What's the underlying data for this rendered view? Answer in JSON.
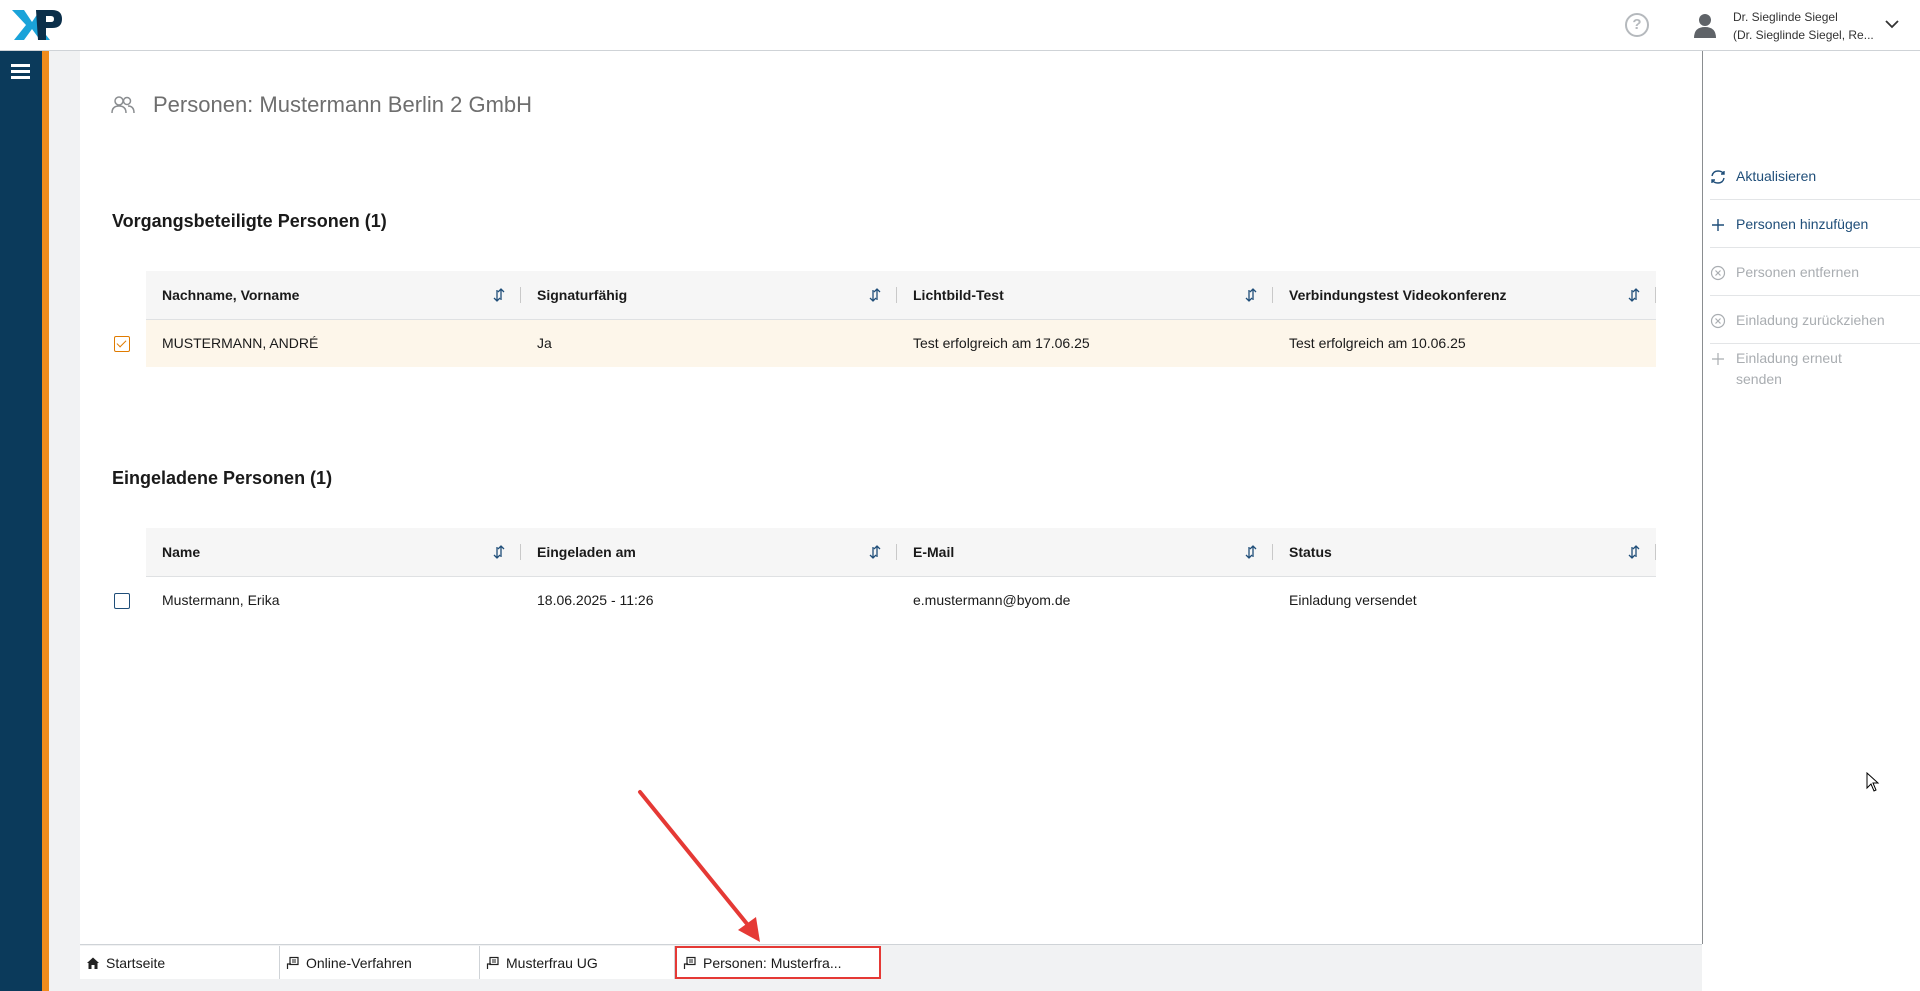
{
  "header": {
    "logo_text": "XP",
    "help_symbol": "?",
    "user": {
      "name": "Dr. Sieglinde Siegel",
      "role": "(Dr. Sieglinde Siegel, Re..."
    }
  },
  "page": {
    "title": "Personen: Mustermann Berlin 2 GmbH"
  },
  "participants": {
    "title": "Vorgangsbeteiligte Personen (1)",
    "columns": [
      "Nachname, Vorname",
      "Signaturfähig",
      "Lichtbild-Test",
      "Verbindungstest Videokonferenz"
    ],
    "rows": [
      {
        "checked": true,
        "name": "MUSTERMANN, ANDRÉ",
        "signature": "Ja",
        "photo_test": "Test erfolgreich am 17.06.25",
        "video_test": "Test erfolgreich am 10.06.25"
      }
    ]
  },
  "invited": {
    "title": "Eingeladene Personen (1)",
    "columns": [
      "Name",
      "Eingeladen am",
      "E-Mail",
      "Status"
    ],
    "rows": [
      {
        "checked": false,
        "name": "Mustermann, Erika",
        "invited_at": "18.06.2025 - 11:26",
        "email": "e.mustermann@byom.de",
        "status": "Einladung versendet"
      }
    ]
  },
  "actions": [
    {
      "label": "Aktualisieren",
      "icon": "refresh-icon",
      "enabled": true
    },
    {
      "label": "Personen hinzufügen",
      "icon": "plus-icon",
      "enabled": true
    },
    {
      "label": "Personen entfernen",
      "icon": "close-circle-icon",
      "enabled": false
    },
    {
      "label": "Einladung zurückziehen",
      "icon": "close-circle-icon",
      "enabled": false
    },
    {
      "label": "Einladung erneut senden",
      "icon": "plus-icon",
      "enabled": false
    }
  ],
  "tabs": [
    {
      "label": "Startseite",
      "icon": "home-icon"
    },
    {
      "label": "Online-Verfahren",
      "icon": "case-icon"
    },
    {
      "label": "Musterfrau UG",
      "icon": "case-icon"
    },
    {
      "label": "Personen: Musterfra...",
      "icon": "case-icon",
      "highlighted": true
    }
  ],
  "colors": {
    "nav": "#0b3a5b",
    "accent": "#f28c1b",
    "link": "#1f4e79",
    "disabled": "#a9adb1",
    "selected_row": "#fdf6ea",
    "annotation": "#e53935"
  }
}
